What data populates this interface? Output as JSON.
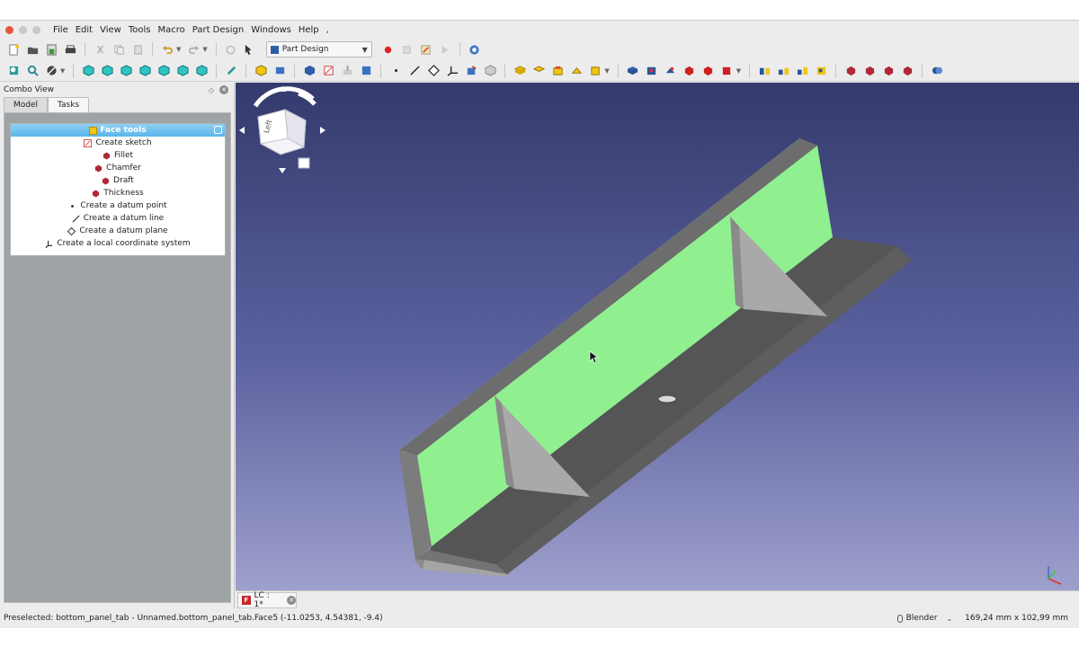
{
  "menubar": {
    "items": [
      "File",
      "Edit",
      "View",
      "Tools",
      "Macro",
      "Part Design",
      "Windows",
      "Help"
    ],
    "extra": ","
  },
  "toolbar": {
    "workbench": "Part Design"
  },
  "combo": {
    "title": "Combo View",
    "tabs": [
      "Model",
      "Tasks"
    ],
    "active_tab": "Tasks"
  },
  "task": {
    "header": "Face tools",
    "items": [
      {
        "label": "Create sketch",
        "icon": "create-sketch-icon",
        "color": "#d64040"
      },
      {
        "label": "Fillet",
        "icon": "fillet-icon",
        "color": "#b0283a"
      },
      {
        "label": "Chamfer",
        "icon": "chamfer-icon",
        "color": "#b0283a"
      },
      {
        "label": "Draft",
        "icon": "draft-icon",
        "color": "#b0283a"
      },
      {
        "label": "Thickness",
        "icon": "thickness-icon",
        "color": "#b0283a"
      },
      {
        "label": "Create a datum point",
        "icon": "datum-point-icon",
        "color": "#222222"
      },
      {
        "label": "Create a datum line",
        "icon": "datum-line-icon",
        "color": "#222222"
      },
      {
        "label": "Create a datum plane",
        "icon": "datum-plane-icon",
        "color": "#222222"
      },
      {
        "label": "Create a local coordinate system",
        "icon": "local-cs-icon",
        "color": "#222222"
      }
    ]
  },
  "navcube": {
    "face_label": "Left"
  },
  "view": {
    "background_top": "#343a6c",
    "background_bottom": "#9ea0cc",
    "highlight_color": "#90f090",
    "part_color": "#666666"
  },
  "doc_tab": {
    "label": "LC : 1*"
  },
  "status": {
    "preselected": "Preselected: bottom_panel_tab - Unnamed.bottom_panel_tab.Face5 (-11.0253, 4.54381, -9.4)",
    "nav_style": "Blender",
    "dimensions": "169,24 mm x 102,99 mm"
  }
}
